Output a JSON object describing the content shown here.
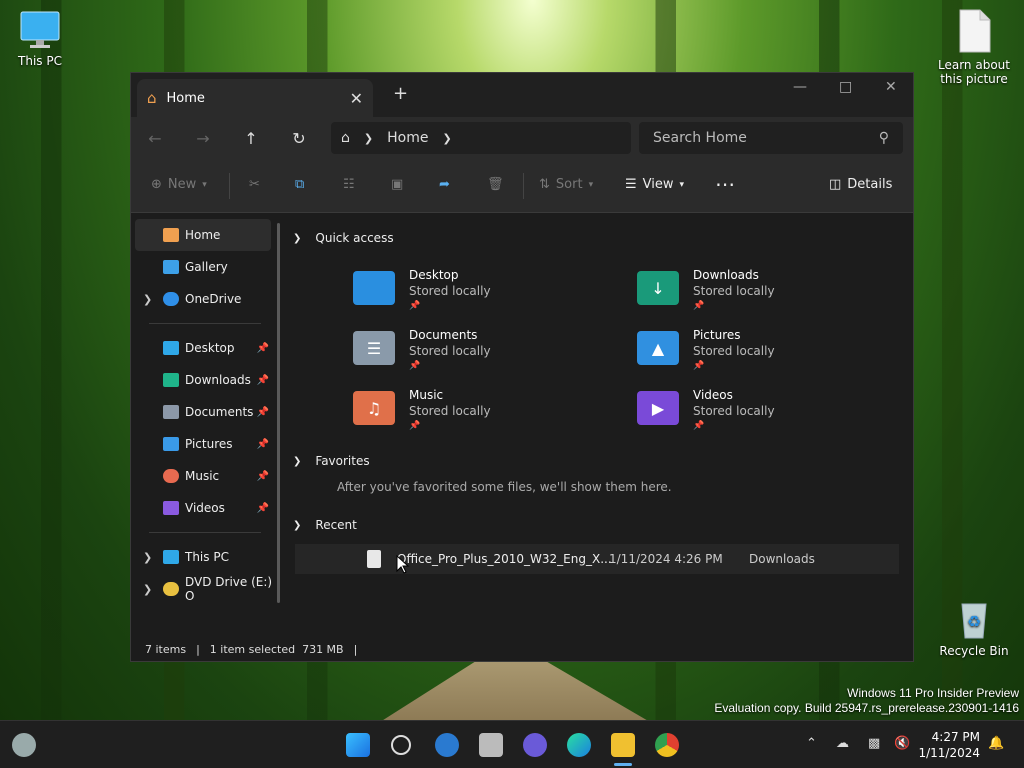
{
  "desktop": {
    "this_pc": "This PC",
    "learn_line1": "Learn about",
    "learn_line2": "this picture",
    "recycle_bin": "Recycle Bin",
    "watermark_line1": "Windows 11 Pro Insider Preview",
    "watermark_line2": "Evaluation copy. Build 25947.rs_prerelease.230901-1416"
  },
  "window": {
    "tab_title": "Home",
    "address": {
      "crumb": "Home"
    },
    "search_placeholder": "Search Home",
    "toolbar": {
      "new": "New",
      "sort": "Sort",
      "view": "View",
      "more": "⋯",
      "details": "Details"
    },
    "sidebar": {
      "top": [
        {
          "label": "Home",
          "icon": "home-icon",
          "color": "#f0a050"
        },
        {
          "label": "Gallery",
          "icon": "gallery-icon",
          "color": "#3da0e8"
        },
        {
          "label": "OneDrive",
          "icon": "cloud-icon",
          "color": "#2f8fe8"
        }
      ],
      "pinned": [
        {
          "label": "Desktop",
          "icon": "desktop-icon",
          "color": "#2fa8e8"
        },
        {
          "label": "Downloads",
          "icon": "download-icon",
          "color": "#1fb48a"
        },
        {
          "label": "Documents",
          "icon": "documents-icon",
          "color": "#8c98a8"
        },
        {
          "label": "Pictures",
          "icon": "pictures-icon",
          "color": "#3a9ae8"
        },
        {
          "label": "Music",
          "icon": "music-icon",
          "color": "#e86a50"
        },
        {
          "label": "Videos",
          "icon": "videos-icon",
          "color": "#8a5ae0"
        }
      ],
      "bottom": [
        {
          "label": "This PC",
          "icon": "pc-icon",
          "color": "#2fa8e8"
        },
        {
          "label": "DVD Drive (E:) O",
          "icon": "dvd-icon",
          "color": "#e8c040"
        }
      ]
    },
    "sections": {
      "quick_access": "Quick access",
      "favorites": "Favorites",
      "favorites_empty": "After you've favorited some files, we'll show them here.",
      "recent": "Recent"
    },
    "quick_access": [
      {
        "name": "Desktop",
        "status": "Stored locally",
        "color": "#2a8fe0"
      },
      {
        "name": "Downloads",
        "status": "Stored locally",
        "color": "#1a9a7a"
      },
      {
        "name": "Documents",
        "status": "Stored locally",
        "color": "#8a9aaa"
      },
      {
        "name": "Pictures",
        "status": "Stored locally",
        "color": "#3090e0"
      },
      {
        "name": "Music",
        "status": "Stored locally",
        "color": "#e0704a"
      },
      {
        "name": "Videos",
        "status": "Stored locally",
        "color": "#7a4ad8"
      }
    ],
    "recent": [
      {
        "name": "Office_Pro_Plus_2010_W32_Eng_X...",
        "date": "1/11/2024 4:26 PM",
        "location": "Downloads"
      }
    ],
    "status": {
      "items": "7 items",
      "selected": "1 item selected  731 MB"
    }
  },
  "taskbar": {
    "time": "4:27 PM",
    "date": "1/11/2024"
  }
}
